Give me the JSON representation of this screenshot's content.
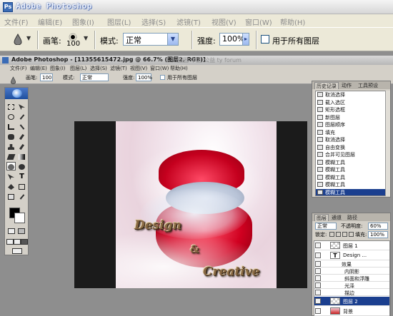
{
  "app": {
    "title": "Adobe Photoshop"
  },
  "menu": [
    "文件(F)",
    "编辑(E)",
    "图象(I)",
    "图层(L)",
    "选择(S)",
    "滤镜(T)",
    "视图(V)",
    "窗口(W)",
    "帮助(H)"
  ],
  "options": {
    "brush_label": "画笔:",
    "brush_size": "100",
    "mode_label": "模式:",
    "mode_value": "正常",
    "strength_label": "强度:",
    "strength_value": "100%",
    "all_layers_label": "用于所有图层"
  },
  "inner_window": {
    "title": "Adobe Photoshop - [11355615472.jpg @ 66.7% (图层2, RGB)]",
    "watermark": "图图 中国 公益 ty forum",
    "menu": [
      "文件(F)",
      "编辑(E)",
      "图象(I)",
      "图层(L)",
      "选择(S)",
      "滤镜(T)",
      "视图(V)",
      "窗口(W)",
      "帮助(H)"
    ],
    "options": {
      "brush_label": "画笔:",
      "brush_size": "100",
      "mode_label": "模式:",
      "mode_value": "正常",
      "strength_label": "强度:",
      "strength_value": "100%",
      "all_layers_label": "用于所有图层"
    }
  },
  "canvas": {
    "word1": "Design",
    "word2": "&",
    "word3": "Creative"
  },
  "history": {
    "tabs": [
      "历史记录",
      "动作",
      "工具预设"
    ],
    "items": [
      "取消选择",
      "载入选区",
      "矩形选框",
      "新图层",
      "图层顺序",
      "填充",
      "取消选择",
      "自由变换",
      "合并可见图层",
      "模糊工具",
      "模糊工具",
      "模糊工具",
      "模糊工具",
      "模糊工具"
    ],
    "selected_index": 13
  },
  "layers": {
    "tabs": [
      "图层",
      "通道",
      "路径"
    ],
    "blend_mode": "正常",
    "opacity_label": "不透明度:",
    "opacity_value": "60%",
    "lock_label": "锁定:",
    "fill_label": "填充:",
    "fill_value": "100%",
    "items": [
      "图层 1",
      "Design ...",
      "效果",
      "内阴影",
      "斜面和浮雕",
      "光泽",
      "描边",
      "图层 2",
      "背景"
    ],
    "selected_index": 7
  }
}
